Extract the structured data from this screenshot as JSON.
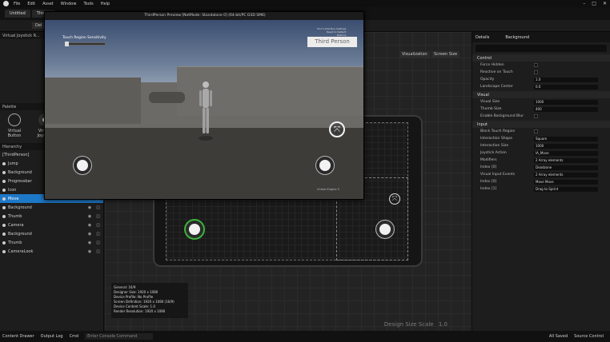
{
  "menubar": {
    "items": [
      "File",
      "Edit",
      "Asset",
      "Window",
      "Tools",
      "Help"
    ]
  },
  "tabs": [
    "Untitled",
    "Third..."
  ],
  "toolbar": {
    "first_tab": "Del"
  },
  "left": {
    "panel1_title": "Virtual Joystick R...",
    "palette_title": "Palette",
    "palette_items": [
      "Virtual Button",
      "Virtual Joystick"
    ],
    "hierarchy_title": "Hierarchy",
    "hierarchy_root": "[ThirdPerson]",
    "rows": [
      "Jump",
      "Background",
      "Progressbar",
      "Icon",
      "Move",
      "Background",
      "Thumb",
      "Camera",
      "Background",
      "Thumb",
      "CameraLook"
    ],
    "selected_index": 4
  },
  "designer": {
    "info_lines": [
      "General: 16/9",
      "Designer Size: 1920 x 1080",
      "Device Profile: No Profile",
      "Screen Definition: 1920 x 1080 (16/9)",
      "Device Content Scale: 1.0",
      "Render Resolution: 1920 x 1080"
    ],
    "design_scale_label": "Design Size Scale",
    "design_scale_value": "1.0",
    "visualization": "Visualization",
    "screen_size": "Screen Size"
  },
  "right": {
    "tab_details": "Details",
    "tab_background": "Background",
    "categories": [
      "Control",
      "Visual",
      "Input"
    ],
    "control_props": [
      {
        "label": "Force Hidden",
        "value": ""
      },
      {
        "label": "Reactive on Touch",
        "value": ""
      },
      {
        "label": "Opacity",
        "value": "1.0"
      },
      {
        "label": "Landscape Center",
        "value": "0.0"
      }
    ],
    "visual_props": [
      {
        "label": "Visual Size",
        "value": "1000"
      },
      {
        "label": "Thumb Size",
        "value": "400"
      },
      {
        "label": "Enable Background Blur",
        "value": ""
      }
    ],
    "input_props": [
      {
        "label": "Block Touch Region",
        "value": ""
      },
      {
        "label": "Interaction Shape",
        "value": "Square"
      },
      {
        "label": "Interaction Size",
        "value": "1000"
      },
      {
        "label": "Joystick Action",
        "value": "IA_Move"
      },
      {
        "label": "Modifiers",
        "value": "2 Array elements"
      },
      {
        "label": "Index [0]",
        "value": "Deadzone"
      },
      {
        "label": "Visual Input Events",
        "value": "2 Array elements"
      },
      {
        "label": "Index [0]",
        "value": "Move Move"
      },
      {
        "label": "Index [1]",
        "value": "Drag to Sprint"
      }
    ]
  },
  "status": {
    "items": [
      "Content Drawer",
      "Output Log",
      "Cmd",
      "Enter Console Command"
    ],
    "right": [
      "All Saved",
      "Source Control"
    ]
  },
  "game": {
    "window_title": "ThirdPerson Preview [NetMode: Standalone 0]  (64-bit/PC D3D SM6)",
    "hud_label": "Touch Region Sensitivity",
    "third_person": "Third Person",
    "small_lines": [
      "Touch Interface Settings",
      "Reset to Default",
      "Options"
    ],
    "branding": "Unreal Engine 5"
  }
}
